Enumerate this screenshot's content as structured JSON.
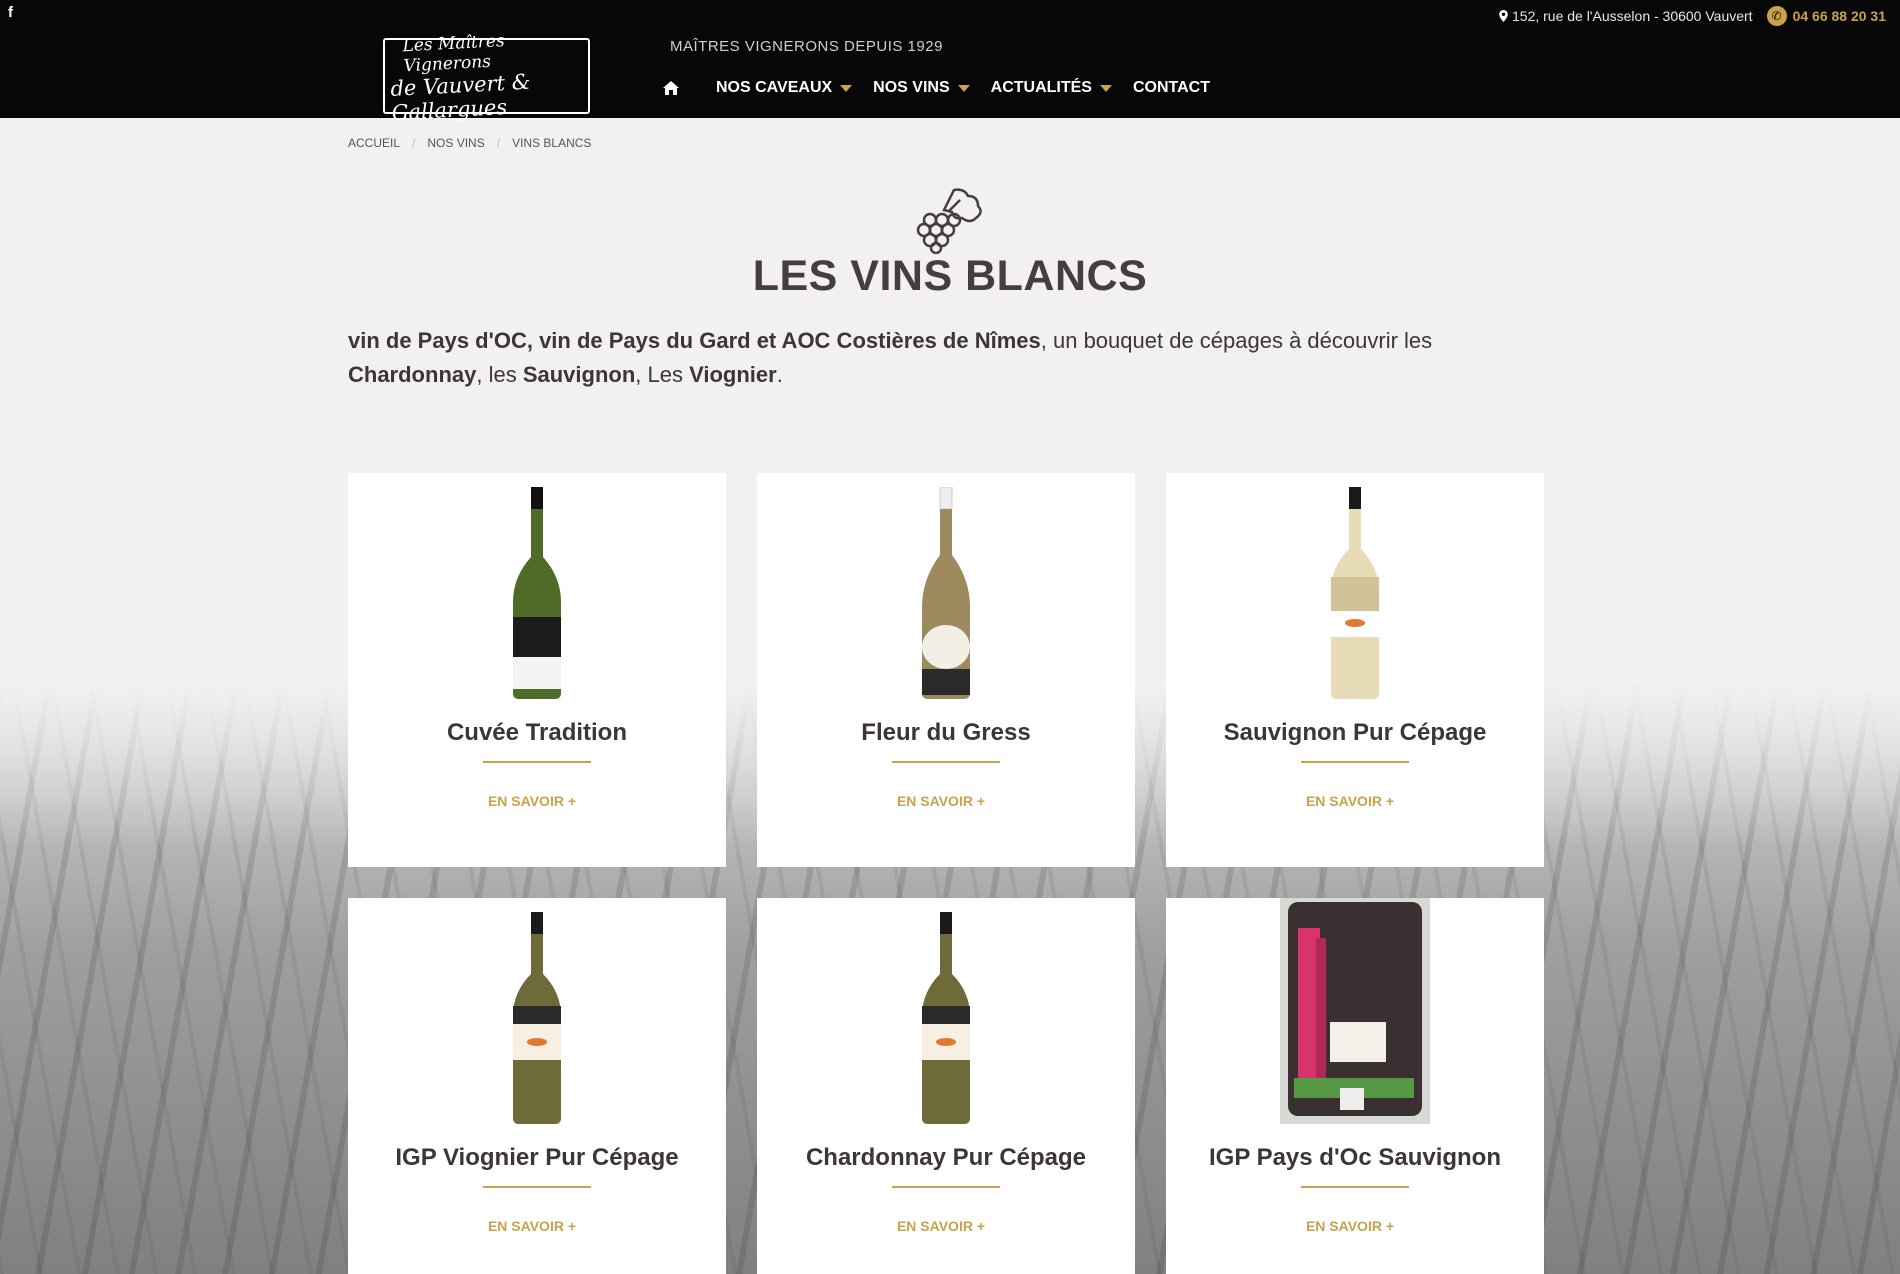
{
  "header": {
    "facebook_glyph": "f",
    "address": "152, rue de l'Ausselon - 30600 Vauvert",
    "phone": "04 66 88 20 31",
    "logo_line1": "Les Maîtres Vignerons",
    "logo_line2": "de Vauvert & Gallargues",
    "tagline": "MAÎTRES VIGNERONS DEPUIS 1929",
    "nav": {
      "home_icon": "home-icon",
      "items": [
        {
          "label": "NOS CAVEAUX",
          "has_dropdown": true
        },
        {
          "label": "NOS VINS",
          "has_dropdown": true
        },
        {
          "label": "ACTUALITÉS",
          "has_dropdown": true
        },
        {
          "label": "CONTACT",
          "has_dropdown": false
        }
      ]
    }
  },
  "breadcrumb": [
    "ACCUEIL",
    "NOS VINS",
    "VINS BLANCS"
  ],
  "breadcrumb_separator": "/",
  "title": "LES VINS BLANCS",
  "intro": {
    "p1": "vin de Pays d'OC, vin de Pays du Gard et AOC Costières de Nîmes",
    "p2": ", un bouquet de cépages à découvrir les ",
    "p3": "Chardonnay",
    "p4": ", les ",
    "p5": "Sauvignon",
    "p6": ", Les ",
    "p7": "Viognier",
    "p8": "."
  },
  "products": [
    {
      "name": "Cuvée Tradition",
      "cta": "EN SAVOIR +",
      "image": "bottle-green"
    },
    {
      "name": "Fleur du Gress",
      "cta": "EN SAVOIR +",
      "image": "bottle-amber"
    },
    {
      "name": "Sauvignon Pur Cépage",
      "cta": "EN SAVOIR +",
      "image": "bottle-clear"
    },
    {
      "name": "IGP Viognier Pur Cépage",
      "cta": "EN SAVOIR +",
      "image": "bottle-olive"
    },
    {
      "name": "Chardonnay Pur Cépage",
      "cta": "EN SAVOIR +",
      "image": "bottle-olive"
    },
    {
      "name": "IGP Pays d'Oc Sauvignon",
      "cta": "EN SAVOIR +",
      "image": "bag-in-box"
    }
  ],
  "colors": {
    "accent": "#c9a24a",
    "header_bg": "#070707",
    "title": "#473d3e"
  }
}
